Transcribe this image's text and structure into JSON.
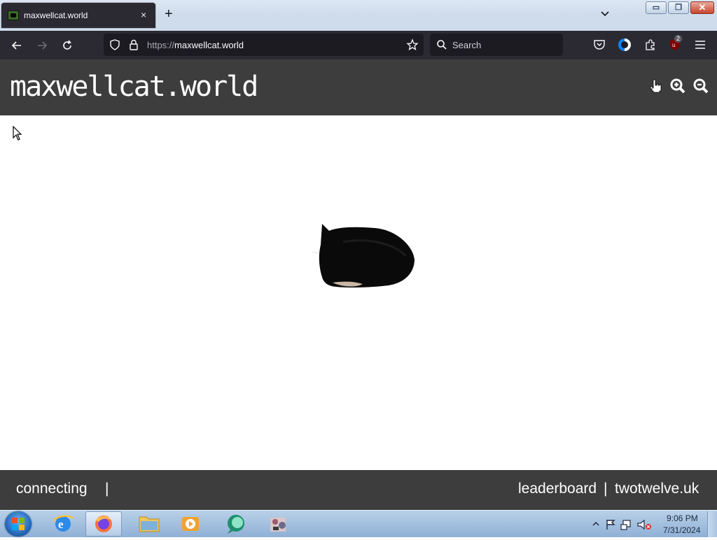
{
  "browser": {
    "tab_title": "maxwellcat.world",
    "tab_close": "×",
    "new_tab": "+",
    "url_protocol": "https://",
    "url_host": "maxwellcat.world",
    "search_placeholder": "Search",
    "extension_badge": "2"
  },
  "window": {
    "minimize": "▭",
    "restore": "❐",
    "close": "✕"
  },
  "site": {
    "title": "maxwellcat.world"
  },
  "footer": {
    "status": "connecting",
    "separator1": "|",
    "leaderboard": "leaderboard",
    "separator2": "|",
    "site_link": "twotwelve.uk"
  },
  "taskbar": {
    "time": "9:06 PM",
    "date": "7/31/2024"
  },
  "colors": {
    "browser_chrome": "#2b2a33",
    "page_header": "#3d3d3d",
    "page_background": "#ffffff"
  }
}
